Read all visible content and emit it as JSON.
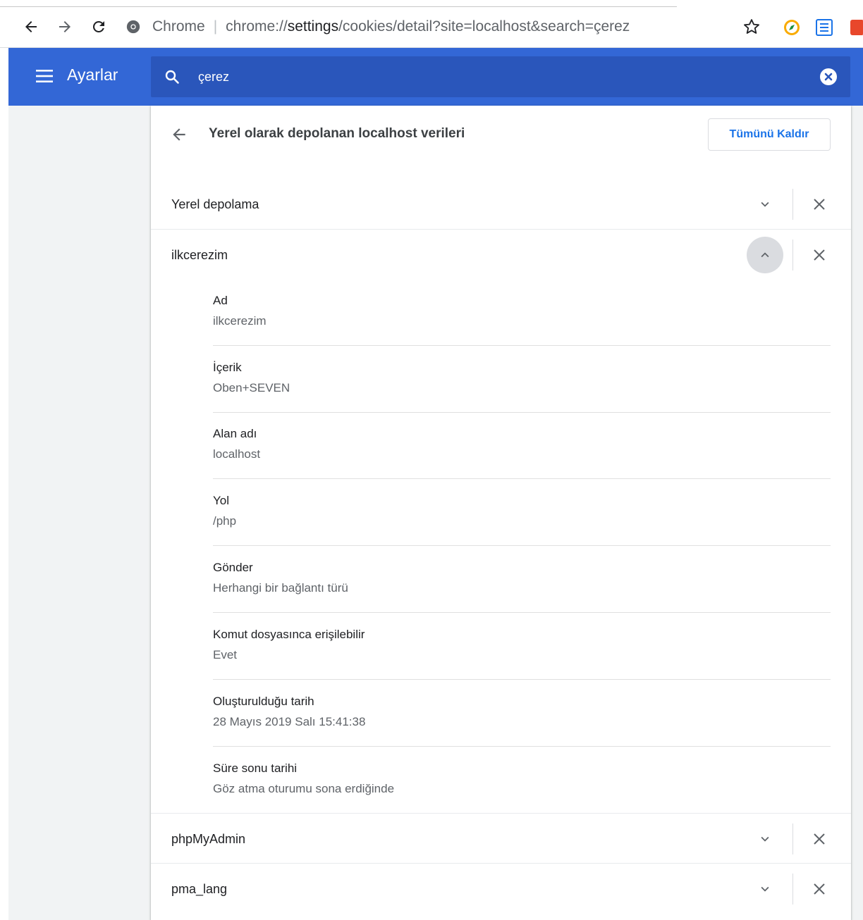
{
  "browser": {
    "omnibox_site": "Chrome",
    "url_scheme": "chrome://",
    "url_host": "settings",
    "url_rest": "/cookies/detail?site=localhost&search=çerez"
  },
  "toolbar": {
    "title": "Ayarlar",
    "search_value": "çerez"
  },
  "header": {
    "title": "Yerel olarak depolanan localhost verileri",
    "remove_all_label": "Tümünü Kaldır"
  },
  "rows": [
    {
      "label": "Yerel depolama"
    },
    {
      "label": "ilkcerezim"
    },
    {
      "label": "phpMyAdmin"
    },
    {
      "label": "pma_lang"
    }
  ],
  "cookie_details": [
    {
      "label": "Ad",
      "value": "ilkcerezim"
    },
    {
      "label": "İçerik",
      "value": "Oben+SEVEN"
    },
    {
      "label": "Alan adı",
      "value": "localhost"
    },
    {
      "label": "Yol",
      "value": "/php"
    },
    {
      "label": "Gönder",
      "value": "Herhangi bir bağlantı türü"
    },
    {
      "label": "Komut dosyasınca erişilebilir",
      "value": "Evet"
    },
    {
      "label": "Oluşturulduğu tarih",
      "value": "28 Mayıs 2019 Salı 15:41:38"
    },
    {
      "label": "Süre sonu tarihi",
      "value": "Göz atma oturumu sona erdiğinde"
    }
  ],
  "colors": {
    "toolbar": "#3367d6",
    "search_box": "#2a56bb",
    "link_blue": "#1a73e8",
    "page_bg": "#f1f3f4"
  },
  "icons": {
    "back": "arrow-left-icon",
    "forward": "arrow-right-icon",
    "reload": "reload-icon",
    "site": "chrome-icon",
    "bookmark": "star-icon",
    "menu": "hamburger-menu-icon",
    "search": "search-icon",
    "clear": "clear-search-icon",
    "expand": "chevron-down-icon",
    "collapse": "chevron-up-icon",
    "remove": "close-icon"
  }
}
